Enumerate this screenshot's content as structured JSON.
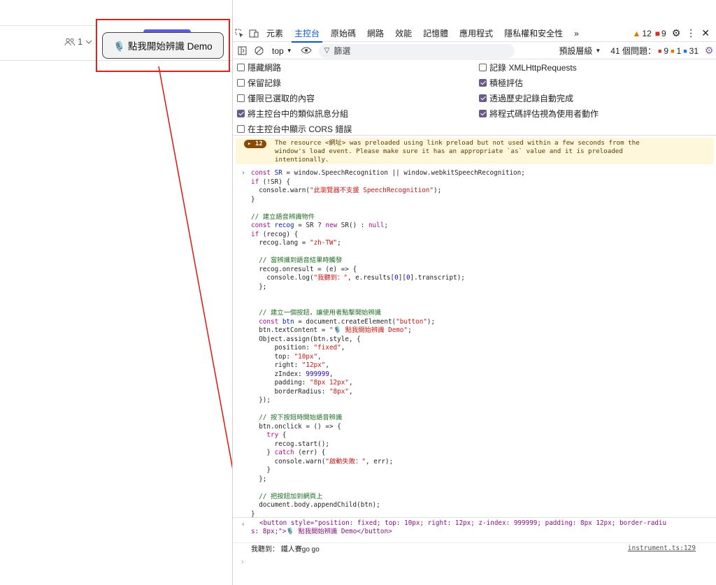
{
  "page": {
    "people_count": "1",
    "injected_button_label": "🎙️ 點我開始辨識 Demo"
  },
  "devtools": {
    "tabs": [
      "元素",
      "主控台",
      "原始碼",
      "網路",
      "效能",
      "記憶體",
      "應用程式",
      "隱私權和安全性"
    ],
    "active_tab": "主控台",
    "more_tabs": "»",
    "warnings_count": "12",
    "errors_count": "9",
    "toolbar": {
      "context": "top",
      "filter_placeholder": "篩選",
      "levels": "預設層級",
      "issues_label": "41 個問題：",
      "issues_errors": "9",
      "issues_warnings": "1",
      "issues_info": "31"
    },
    "settings": [
      {
        "label": "隱藏網路",
        "checked": false
      },
      {
        "label": "保留記錄",
        "checked": false
      },
      {
        "label": "僅限已選取的內容",
        "checked": false
      },
      {
        "label": "將主控台中的類似訊息分組",
        "checked": true
      },
      {
        "label": "在主控台中顯示 CORS 錯誤",
        "checked": false
      },
      {
        "label": "記錄 XMLHttpRequests",
        "checked": false
      },
      {
        "label": "積極評估",
        "checked": true
      },
      {
        "label": "透過歷史記錄自動完成",
        "checked": true
      },
      {
        "label": "將程式碼評估視為使用者動作",
        "checked": true
      }
    ],
    "warning": {
      "count": "12",
      "line1": "The resource <網址> was preloaded using link preload but not used within a few seconds from the",
      "line2": "window's load event. Please make sure it has an appropriate `as` value and it is preloaded",
      "line3": "intentionally."
    },
    "result": {
      "line1": "<button style=\"position: fixed; top: 10px; right: 12px; z-index: 999999; padding: 8px 12px; border-radiu",
      "line2": "s: 8px;\">🎙️ 點我開始辨識 Demo</button>"
    },
    "log": {
      "text": "我聽到： 鐵人賽go go",
      "source": "instrument.ts:129"
    },
    "final_prompt": "›"
  }
}
